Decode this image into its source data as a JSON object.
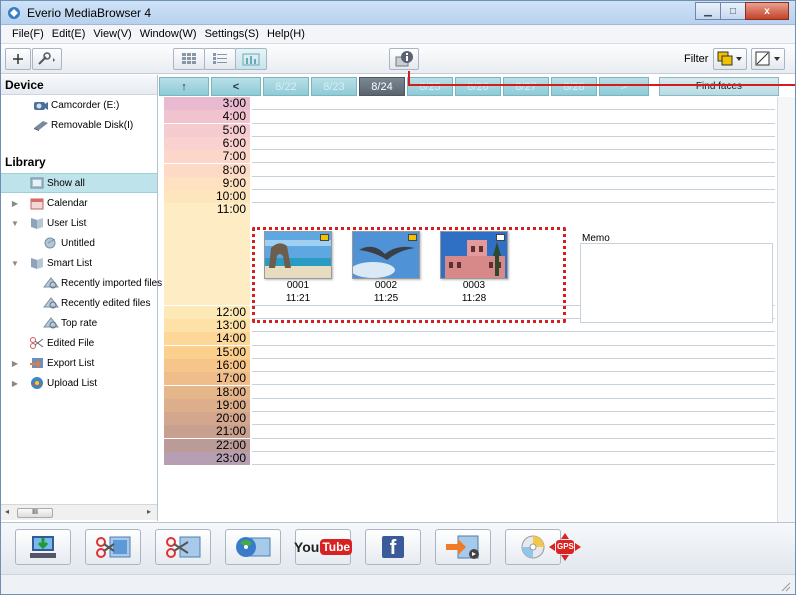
{
  "window": {
    "title": "Everio MediaBrowser 4",
    "controls": {
      "minimize": "▁",
      "maximize": "□",
      "close": "x"
    }
  },
  "menubar": {
    "items": [
      "File(F)",
      "Edit(E)",
      "View(V)",
      "Window(W)",
      "Settings(S)",
      "Help(H)"
    ]
  },
  "toolbar": {
    "add_icon": "plus-icon",
    "settings_icon": "wrench-icon",
    "filter_label": "Filter"
  },
  "sidebar": {
    "device_header": "Device",
    "devices": [
      "Camcorder (E:)",
      "Removable Disk(I)"
    ],
    "library_header": "Library",
    "library": [
      {
        "label": "Show all",
        "selected": true,
        "expander": ""
      },
      {
        "label": "Calendar",
        "expander": "▶"
      },
      {
        "label": "User List",
        "expander": "▼"
      },
      {
        "label": "Untitled",
        "expander": ""
      },
      {
        "label": "Smart List",
        "expander": "▼"
      },
      {
        "label": "Recently imported files",
        "expander": ""
      },
      {
        "label": "Recently edited files",
        "expander": ""
      },
      {
        "label": "Top rate",
        "expander": ""
      },
      {
        "label": "Edited File",
        "expander": ""
      },
      {
        "label": "Export List",
        "expander": "▶"
      },
      {
        "label": "Upload List",
        "expander": "▶"
      }
    ],
    "scroll_thumb": "III"
  },
  "datebar": {
    "up_label": "↑",
    "prev_label": "<",
    "dates": [
      "8/22",
      "8/23",
      "8/24",
      "8/25",
      "8/26",
      "8/27",
      "8/28"
    ],
    "active_date": "8/24",
    "next_label": ">",
    "find_faces": "Find faces"
  },
  "timeline": {
    "hours": [
      "3:00",
      "4:00",
      "5:00",
      "6:00",
      "7:00",
      "8:00",
      "9:00",
      "10:00",
      "11:00",
      "12:00",
      "13:00",
      "14:00",
      "15:00",
      "16:00",
      "17:00",
      "18:00",
      "19:00",
      "20:00",
      "21:00",
      "22:00",
      "23:00"
    ],
    "hour_colors": [
      "#e8b9cf",
      "#f1c3cf",
      "#f6cbcf",
      "#f9d2cf",
      "#fbd6c9",
      "#fcdac5",
      "#fde1c1",
      "#fde6bd",
      "#fdecc4",
      "#fde9b5",
      "#fde1a6",
      "#fcd798",
      "#fbcf8c",
      "#f6c58a",
      "#efbd8a",
      "#e6b68b",
      "#dcae8c",
      "#d3a68e",
      "#c8a08f",
      "#bb9b98",
      "#b69fb2"
    ],
    "memo_label": "Memo",
    "thumbnails": [
      {
        "id": "0001",
        "time": "11:21",
        "subject": "beach-arch"
      },
      {
        "id": "0002",
        "time": "11:25",
        "subject": "seagull"
      },
      {
        "id": "0003",
        "time": "11:28",
        "subject": "pink-building"
      }
    ]
  },
  "actionbar": {
    "buttons": [
      "import-icon",
      "edit-video-icon",
      "cut-icon",
      "disc-create-icon",
      "youtube-upload",
      "facebook-upload",
      "export-icon",
      "disc-icon",
      "gps-icon"
    ],
    "youtube_text_you": "You",
    "youtube_text_tube": "Tube",
    "facebook_text": "f",
    "gps_text": "GPS"
  },
  "colors": {
    "accent": "#8ecbd7",
    "selection_border": "#d42020"
  }
}
